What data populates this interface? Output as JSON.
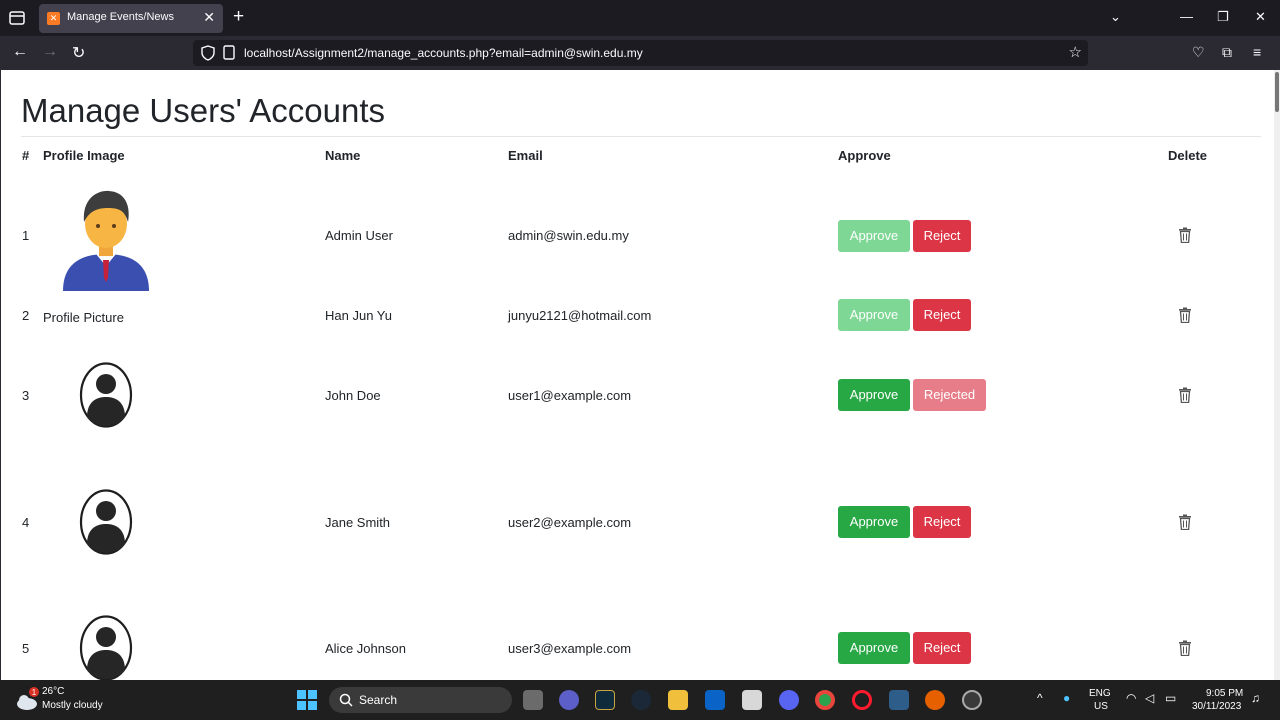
{
  "browser": {
    "tab_title": "Manage Events/News",
    "url": "localhost/Assignment2/manage_accounts.php?email=admin@swin.edu.my"
  },
  "page": {
    "title": "Manage Users' Accounts",
    "headers": {
      "num": "#",
      "profile": "Profile Image",
      "name": "Name",
      "email": "Email",
      "approve": "Approve",
      "delete": "Delete"
    },
    "approve_label": "Approve",
    "reject_label": "Reject",
    "rejected_label": "Rejected",
    "rows": [
      {
        "num": "1",
        "profile": "admin-avatar",
        "name": "Admin User",
        "email": "admin@swin.edu.my",
        "approve_enabled": false,
        "reject_label": "Reject",
        "reject_faded": false
      },
      {
        "num": "2",
        "profile_alt": "Profile Picture",
        "name": "Han Jun Yu",
        "email": "junyu2121@hotmail.com",
        "approve_enabled": false,
        "reject_label": "Reject",
        "reject_faded": false
      },
      {
        "num": "3",
        "profile": "user-silhouette",
        "name": "John Doe",
        "email": "user1@example.com",
        "approve_enabled": true,
        "reject_label": "Rejected",
        "reject_faded": true
      },
      {
        "num": "4",
        "profile": "user-silhouette",
        "name": "Jane Smith",
        "email": "user2@example.com",
        "approve_enabled": true,
        "reject_label": "Reject",
        "reject_faded": false
      },
      {
        "num": "5",
        "profile": "user-silhouette",
        "name": "Alice Johnson",
        "email": "user3@example.com",
        "approve_enabled": true,
        "reject_label": "Reject",
        "reject_faded": false
      }
    ]
  },
  "taskbar": {
    "weather_badge": "1",
    "temperature": "26°C",
    "weather": "Mostly cloudy",
    "search_label": "Search",
    "lang": "ENG",
    "region": "US",
    "time": "9:05 PM",
    "date": "30/11/2023"
  },
  "colors": {
    "approve": "#28a745",
    "reject": "#dc3545",
    "chrome_dark": "#1c1b22"
  }
}
